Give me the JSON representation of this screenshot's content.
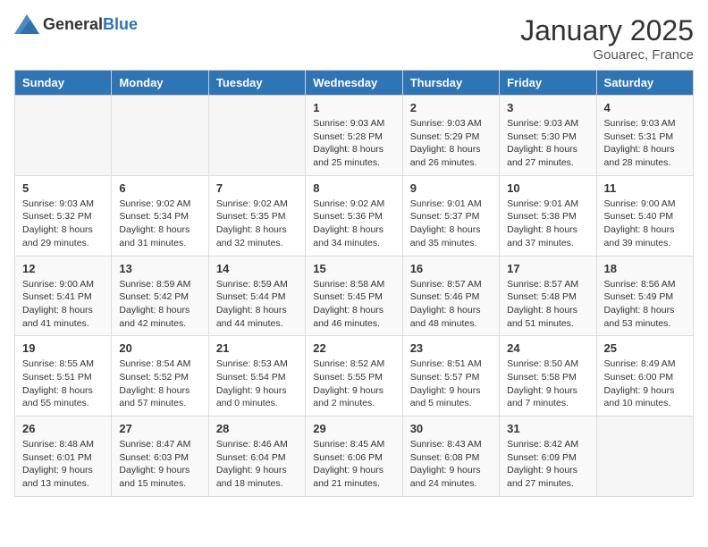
{
  "logo": {
    "general": "General",
    "blue": "Blue"
  },
  "title": "January 2025",
  "location": "Gouarec, France",
  "days_of_week": [
    "Sunday",
    "Monday",
    "Tuesday",
    "Wednesday",
    "Thursday",
    "Friday",
    "Saturday"
  ],
  "weeks": [
    [
      {
        "day": "",
        "info": ""
      },
      {
        "day": "",
        "info": ""
      },
      {
        "day": "",
        "info": ""
      },
      {
        "day": "1",
        "info": "Sunrise: 9:03 AM\nSunset: 5:28 PM\nDaylight: 8 hours and 25 minutes."
      },
      {
        "day": "2",
        "info": "Sunrise: 9:03 AM\nSunset: 5:29 PM\nDaylight: 8 hours and 26 minutes."
      },
      {
        "day": "3",
        "info": "Sunrise: 9:03 AM\nSunset: 5:30 PM\nDaylight: 8 hours and 27 minutes."
      },
      {
        "day": "4",
        "info": "Sunrise: 9:03 AM\nSunset: 5:31 PM\nDaylight: 8 hours and 28 minutes."
      }
    ],
    [
      {
        "day": "5",
        "info": "Sunrise: 9:03 AM\nSunset: 5:32 PM\nDaylight: 8 hours and 29 minutes."
      },
      {
        "day": "6",
        "info": "Sunrise: 9:02 AM\nSunset: 5:34 PM\nDaylight: 8 hours and 31 minutes."
      },
      {
        "day": "7",
        "info": "Sunrise: 9:02 AM\nSunset: 5:35 PM\nDaylight: 8 hours and 32 minutes."
      },
      {
        "day": "8",
        "info": "Sunrise: 9:02 AM\nSunset: 5:36 PM\nDaylight: 8 hours and 34 minutes."
      },
      {
        "day": "9",
        "info": "Sunrise: 9:01 AM\nSunset: 5:37 PM\nDaylight: 8 hours and 35 minutes."
      },
      {
        "day": "10",
        "info": "Sunrise: 9:01 AM\nSunset: 5:38 PM\nDaylight: 8 hours and 37 minutes."
      },
      {
        "day": "11",
        "info": "Sunrise: 9:00 AM\nSunset: 5:40 PM\nDaylight: 8 hours and 39 minutes."
      }
    ],
    [
      {
        "day": "12",
        "info": "Sunrise: 9:00 AM\nSunset: 5:41 PM\nDaylight: 8 hours and 41 minutes."
      },
      {
        "day": "13",
        "info": "Sunrise: 8:59 AM\nSunset: 5:42 PM\nDaylight: 8 hours and 42 minutes."
      },
      {
        "day": "14",
        "info": "Sunrise: 8:59 AM\nSunset: 5:44 PM\nDaylight: 8 hours and 44 minutes."
      },
      {
        "day": "15",
        "info": "Sunrise: 8:58 AM\nSunset: 5:45 PM\nDaylight: 8 hours and 46 minutes."
      },
      {
        "day": "16",
        "info": "Sunrise: 8:57 AM\nSunset: 5:46 PM\nDaylight: 8 hours and 48 minutes."
      },
      {
        "day": "17",
        "info": "Sunrise: 8:57 AM\nSunset: 5:48 PM\nDaylight: 8 hours and 51 minutes."
      },
      {
        "day": "18",
        "info": "Sunrise: 8:56 AM\nSunset: 5:49 PM\nDaylight: 8 hours and 53 minutes."
      }
    ],
    [
      {
        "day": "19",
        "info": "Sunrise: 8:55 AM\nSunset: 5:51 PM\nDaylight: 8 hours and 55 minutes."
      },
      {
        "day": "20",
        "info": "Sunrise: 8:54 AM\nSunset: 5:52 PM\nDaylight: 8 hours and 57 minutes."
      },
      {
        "day": "21",
        "info": "Sunrise: 8:53 AM\nSunset: 5:54 PM\nDaylight: 9 hours and 0 minutes."
      },
      {
        "day": "22",
        "info": "Sunrise: 8:52 AM\nSunset: 5:55 PM\nDaylight: 9 hours and 2 minutes."
      },
      {
        "day": "23",
        "info": "Sunrise: 8:51 AM\nSunset: 5:57 PM\nDaylight: 9 hours and 5 minutes."
      },
      {
        "day": "24",
        "info": "Sunrise: 8:50 AM\nSunset: 5:58 PM\nDaylight: 9 hours and 7 minutes."
      },
      {
        "day": "25",
        "info": "Sunrise: 8:49 AM\nSunset: 6:00 PM\nDaylight: 9 hours and 10 minutes."
      }
    ],
    [
      {
        "day": "26",
        "info": "Sunrise: 8:48 AM\nSunset: 6:01 PM\nDaylight: 9 hours and 13 minutes."
      },
      {
        "day": "27",
        "info": "Sunrise: 8:47 AM\nSunset: 6:03 PM\nDaylight: 9 hours and 15 minutes."
      },
      {
        "day": "28",
        "info": "Sunrise: 8:46 AM\nSunset: 6:04 PM\nDaylight: 9 hours and 18 minutes."
      },
      {
        "day": "29",
        "info": "Sunrise: 8:45 AM\nSunset: 6:06 PM\nDaylight: 9 hours and 21 minutes."
      },
      {
        "day": "30",
        "info": "Sunrise: 8:43 AM\nSunset: 6:08 PM\nDaylight: 9 hours and 24 minutes."
      },
      {
        "day": "31",
        "info": "Sunrise: 8:42 AM\nSunset: 6:09 PM\nDaylight: 9 hours and 27 minutes."
      },
      {
        "day": "",
        "info": ""
      }
    ]
  ]
}
